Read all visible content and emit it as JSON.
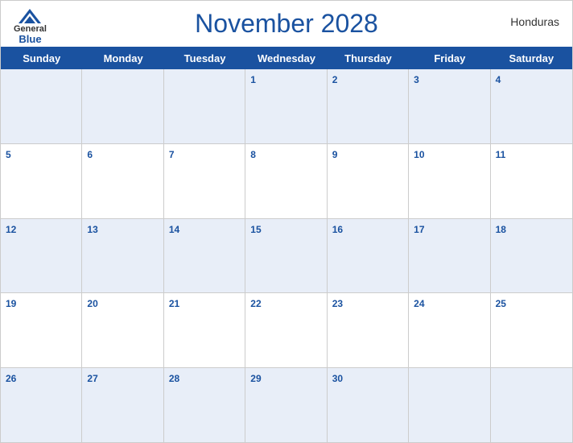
{
  "header": {
    "title": "November 2028",
    "country": "Honduras",
    "logo": {
      "general": "General",
      "blue": "Blue"
    }
  },
  "days": {
    "headers": [
      "Sunday",
      "Monday",
      "Tuesday",
      "Wednesday",
      "Thursday",
      "Friday",
      "Saturday"
    ]
  },
  "weeks": [
    [
      {
        "num": "",
        "empty": true
      },
      {
        "num": "",
        "empty": true
      },
      {
        "num": "",
        "empty": true
      },
      {
        "num": "1"
      },
      {
        "num": "2"
      },
      {
        "num": "3"
      },
      {
        "num": "4"
      }
    ],
    [
      {
        "num": "5"
      },
      {
        "num": "6"
      },
      {
        "num": "7"
      },
      {
        "num": "8"
      },
      {
        "num": "9"
      },
      {
        "num": "10"
      },
      {
        "num": "11"
      }
    ],
    [
      {
        "num": "12"
      },
      {
        "num": "13"
      },
      {
        "num": "14"
      },
      {
        "num": "15"
      },
      {
        "num": "16"
      },
      {
        "num": "17"
      },
      {
        "num": "18"
      }
    ],
    [
      {
        "num": "19"
      },
      {
        "num": "20"
      },
      {
        "num": "21"
      },
      {
        "num": "22"
      },
      {
        "num": "23"
      },
      {
        "num": "24"
      },
      {
        "num": "25"
      }
    ],
    [
      {
        "num": "26"
      },
      {
        "num": "27"
      },
      {
        "num": "28"
      },
      {
        "num": "29"
      },
      {
        "num": "30"
      },
      {
        "num": "",
        "empty": true
      },
      {
        "num": "",
        "empty": true
      }
    ]
  ]
}
